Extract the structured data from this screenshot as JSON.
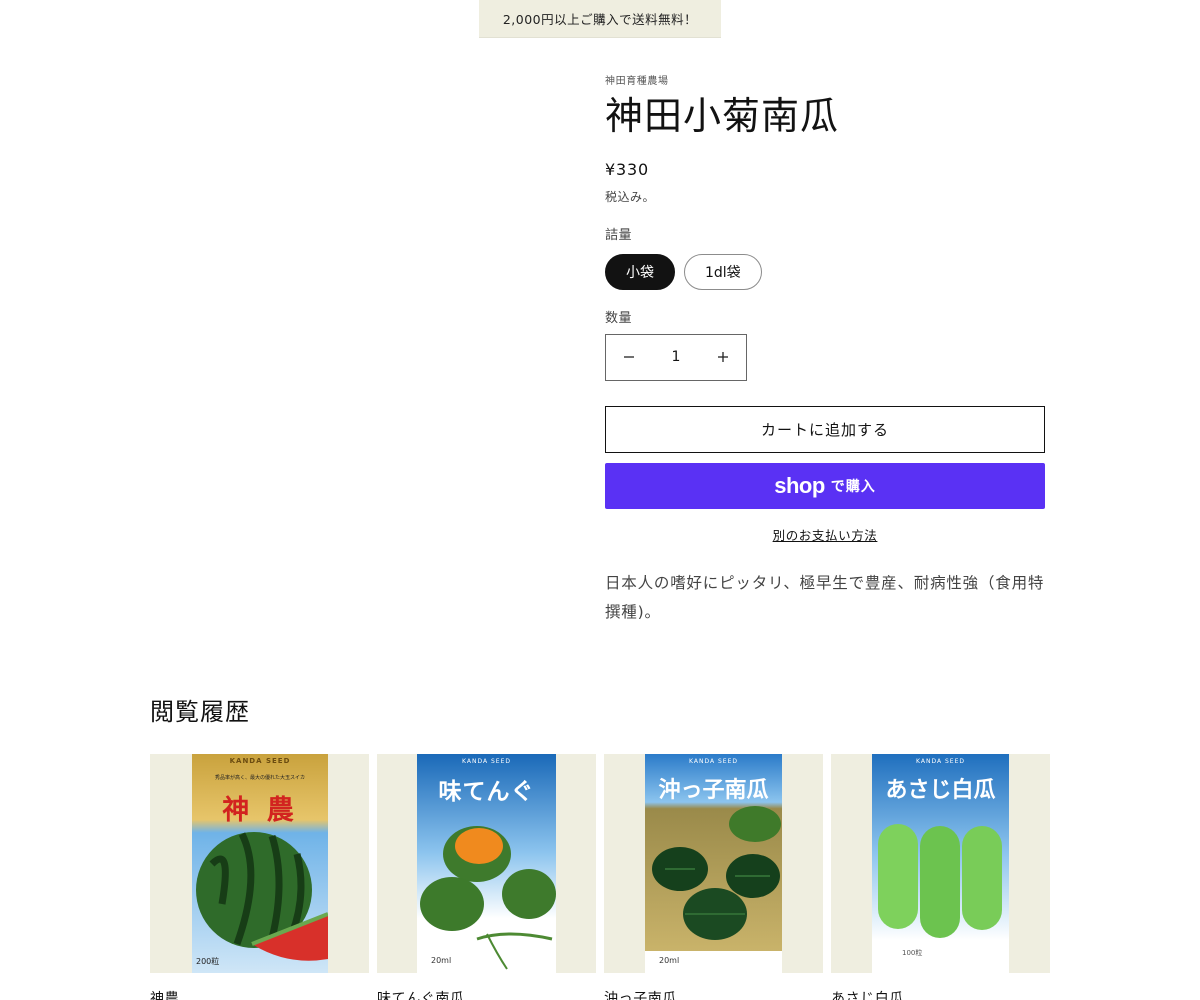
{
  "announcement": "2,000円以上ご購入で送料無料！",
  "product": {
    "vendor": "神田育種農場",
    "title": "神田小菊南瓜",
    "price": "¥330",
    "tax_note": "税込み。",
    "variant_label": "詰量",
    "variants": [
      "小袋",
      "1dl袋"
    ],
    "selected_variant": "小袋",
    "quantity_label": "数量",
    "quantity": "1",
    "add_to_cart": "カートに追加する",
    "shop_pay_logo": "shop",
    "shop_pay_text": "で購入",
    "more_payment": "別のお支払い方法",
    "description": "日本人の嗜好にピッタリ、極早生で豊産、耐病性強（食用特撰種)。"
  },
  "recently_viewed": {
    "title": "閲覧履歴",
    "items": [
      {
        "name": "神農",
        "packet_title": "神 農",
        "packet_brand": "KANDA SEED",
        "packet_tagline": "秀品率が高く、最大の優れた大玉スイカ",
        "packet_amount": "200粒"
      },
      {
        "name": "味てんぐ南瓜",
        "packet_title": "味てんぐ",
        "packet_brand": "KANDA SEED",
        "packet_amount": "20ml"
      },
      {
        "name": "沖っ子南瓜",
        "packet_title": "沖っ子南瓜",
        "packet_brand": "KANDA SEED",
        "packet_amount": "20ml"
      },
      {
        "name": "あさじ白瓜",
        "packet_title": "あさじ白瓜",
        "packet_brand": "KANDA SEED",
        "packet_amount": "100粒"
      }
    ]
  },
  "colors": {
    "accent_shop": "#5a31f4",
    "announcement_bg": "#efeee0",
    "card_bg": "#efeee0",
    "text": "#121212"
  }
}
